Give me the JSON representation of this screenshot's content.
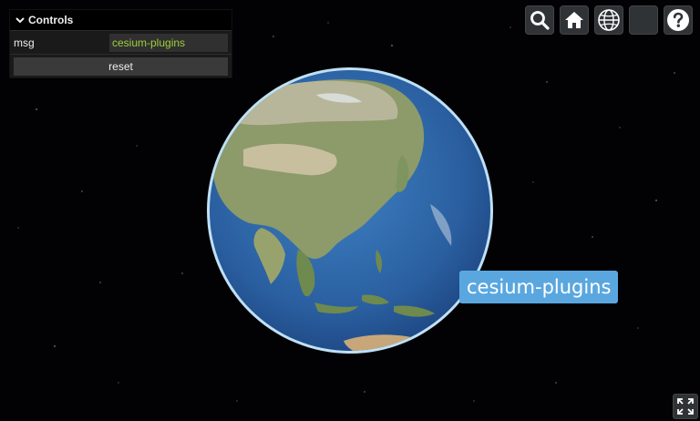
{
  "controls": {
    "title": "Controls",
    "msg_label": "msg",
    "msg_value": "cesium-plugins",
    "reset_label": "reset"
  },
  "toolbar": {
    "icons": [
      "search-icon",
      "home-icon",
      "globe-icon",
      "blank-icon",
      "help-icon"
    ]
  },
  "map_label": {
    "text": "cesium-plugins"
  },
  "colors": {
    "accent_label_bg": "#5aa7e0",
    "input_text": "#9ed03a"
  }
}
